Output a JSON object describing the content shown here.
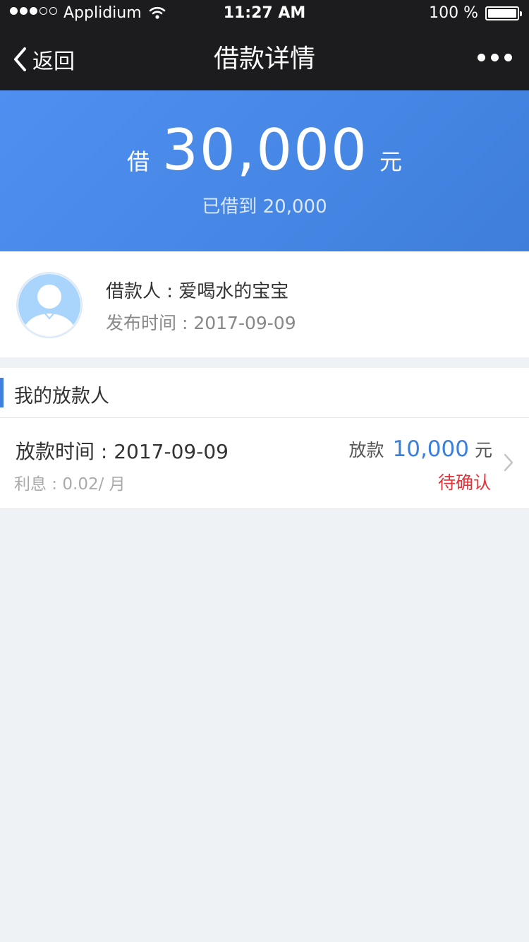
{
  "status_bar": {
    "carrier": "Applidium",
    "time": "11:27 AM",
    "battery": "100 %"
  },
  "nav": {
    "back_label": "返回",
    "title": "借款详情"
  },
  "summary": {
    "prefix": "借",
    "amount": "30,000",
    "unit": "元",
    "borrowed_text": "已借到 20,000"
  },
  "borrower": {
    "name_line": "借款人 : 爱喝水的宝宝",
    "publish_line": "发布时间 : 2017-09-09"
  },
  "lenders_section": {
    "title": "我的放款人",
    "items": [
      {
        "time_line": "放款时间 : 2017-09-09",
        "interest_line": "利息 : 0.02/ 月",
        "amount_prefix": "放款",
        "amount": "10,000",
        "amount_unit": "元",
        "status": "待确认"
      }
    ]
  },
  "colors": {
    "nav_background": "#1c1c1f",
    "summary_background": "#4a88e8",
    "accent_blue": "#3a7fdc",
    "status_red": "#e0353a",
    "page_background": "#eef2f5"
  },
  "icons": {
    "back": "chevron-left-icon",
    "more": "more-dots-icon",
    "wifi": "wifi-icon",
    "battery": "battery-icon",
    "avatar": "user-avatar-icon",
    "row_arrow": "chevron-right-icon"
  }
}
